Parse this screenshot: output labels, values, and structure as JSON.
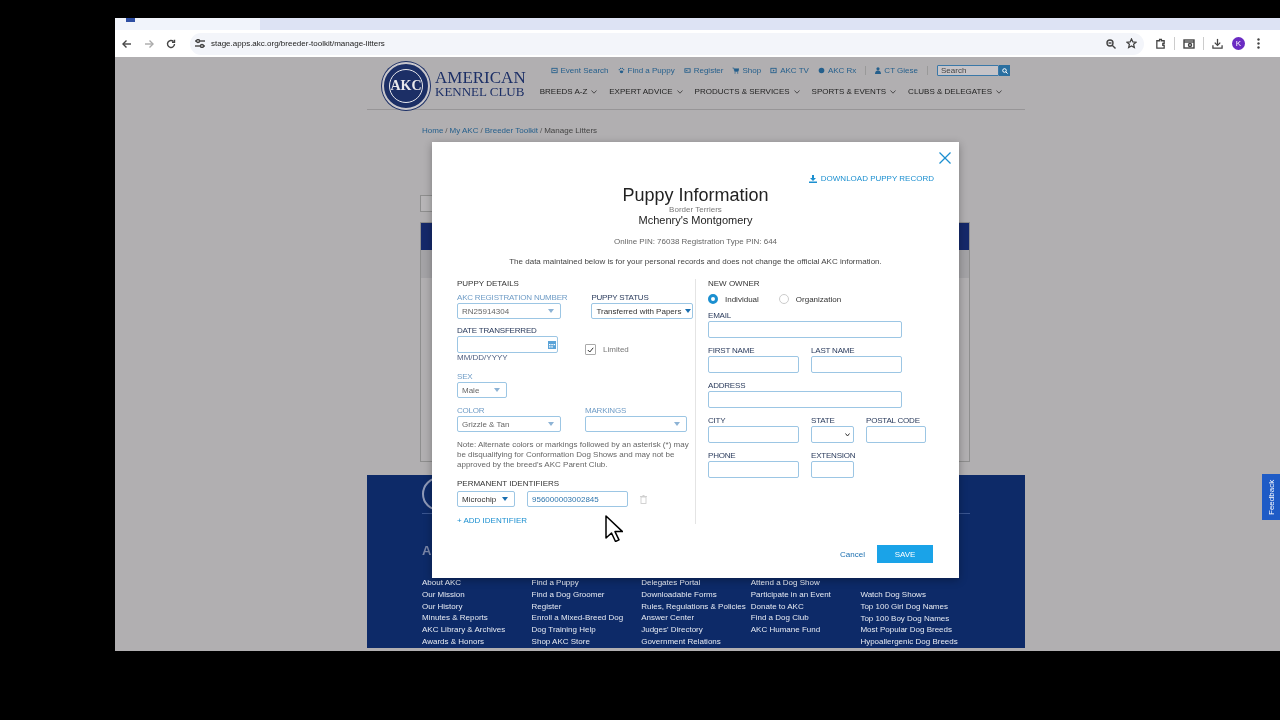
{
  "browser": {
    "url": "stage.apps.akc.org/breeder-toolkit/manage-litters",
    "profile_initial": "K"
  },
  "header": {
    "logo_mark": "AKC",
    "logo_line1": "AMERICAN",
    "logo_line2": "KENNEL CLUB",
    "utility_links": [
      {
        "label": "Event Search"
      },
      {
        "label": "Find a Puppy"
      },
      {
        "label": "Register"
      },
      {
        "label": "Shop"
      },
      {
        "label": "AKC TV"
      },
      {
        "label": "AKC Rx"
      }
    ],
    "user": "CT Giese",
    "search_placeholder": "Search",
    "main_nav": [
      {
        "label": "BREEDS A-Z"
      },
      {
        "label": "EXPERT ADVICE"
      },
      {
        "label": "PRODUCTS & SERVICES"
      },
      {
        "label": "SPORTS & EVENTS"
      },
      {
        "label": "CLUBS & DELEGATES"
      }
    ]
  },
  "breadcrumb": {
    "separator": "/",
    "items": [
      {
        "label": "Home",
        "current": false
      },
      {
        "label": "My AKC",
        "current": false
      },
      {
        "label": "Breeder Toolkit",
        "current": false
      },
      {
        "label": "Manage Litters",
        "current": true
      }
    ]
  },
  "modal": {
    "download_label": "DOWNLOAD PUPPY RECORD",
    "title": "Puppy Information",
    "breed": "Border Terriers",
    "name": "Mchenry's Montgomery",
    "pin_line": "Online PIN: 76038 Registration Type PIN: 644",
    "notice": "The data maintained below is for your personal records and does not change the official AKC information.",
    "puppy_details": {
      "heading": "PUPPY DETAILS",
      "registration": {
        "label": "AKC REGISTRATION NUMBER",
        "value": "RN25914304",
        "disabled": true
      },
      "status": {
        "label": "PUPPY STATUS",
        "value": "Transferred with Papers",
        "disabled": false
      },
      "date_transferred": {
        "label": "DATE TRANSFERRED",
        "hint": "MM/DD/YYYY"
      },
      "limited": {
        "label": "Limited",
        "checked": true
      },
      "sex": {
        "label": "SEX",
        "value": "Male",
        "disabled": true
      },
      "color": {
        "label": "COLOR",
        "value": "Grizzle & Tan",
        "disabled": true
      },
      "markings": {
        "label": "MARKINGS",
        "disabled": true
      },
      "note": "Note: Alternate colors or markings followed by an asterisk (*) may be disqualifying for Conformation Dog Shows and may not be approved by the breed's AKC Parent Club."
    },
    "identifiers": {
      "heading": "PERMANENT IDENTIFIERS",
      "type": "Microchip",
      "number": "956000003002845",
      "add_label": "+ ADD IDENTIFIER"
    },
    "new_owner": {
      "heading": "NEW OWNER",
      "owner_types": [
        {
          "label": "Individual",
          "selected": true
        },
        {
          "label": "Organization",
          "selected": false
        }
      ],
      "rows": [
        [
          {
            "label": "EMAIL",
            "kind": "text"
          }
        ],
        [
          {
            "label": "FIRST NAME",
            "kind": "text"
          },
          {
            "label": "LAST NAME",
            "kind": "text"
          }
        ],
        [
          {
            "label": "ADDRESS",
            "kind": "text"
          }
        ],
        [
          {
            "label": "CITY",
            "kind": "text"
          },
          {
            "label": "STATE",
            "kind": "select"
          },
          {
            "label": "POSTAL CODE",
            "kind": "text"
          }
        ],
        [
          {
            "label": "PHONE",
            "kind": "text"
          },
          {
            "label": "EXTENSION",
            "kind": "text"
          }
        ]
      ]
    },
    "buttons": {
      "cancel": "Cancel",
      "save": "SAVE"
    }
  },
  "footer": {
    "heading": "A",
    "columns": [
      {
        "links": [
          "About AKC",
          "Our Mission",
          "Our History",
          "Minutes & Reports",
          "AKC Library & Archives",
          "Awards & Honors"
        ]
      },
      {
        "links": [
          "Find a Puppy",
          "Find a Dog Groomer",
          "Register",
          "Enroll a Mixed-Breed Dog",
          "Dog Training Help",
          "Shop AKC Store"
        ]
      },
      {
        "links": [
          "Delegates Portal",
          "Downloadable Forms",
          "Rules, Regulations & Policies",
          "Answer Center",
          "Judges' Directory",
          "Government Relations"
        ]
      },
      {
        "links": [
          "Attend a Dog Show",
          "Participate in an Event",
          "Donate to AKC",
          "Find a Dog Club",
          "AKC Humane Fund"
        ]
      },
      {
        "links": [
          "Watch Dog Shows",
          "Top 100 Girl Dog Names",
          "Top 100 Boy Dog Names",
          "Most Popular Dog Breeds",
          "Hypoallergenic Dog Breeds"
        ]
      }
    ]
  },
  "feedback_tab": "Feedback"
}
